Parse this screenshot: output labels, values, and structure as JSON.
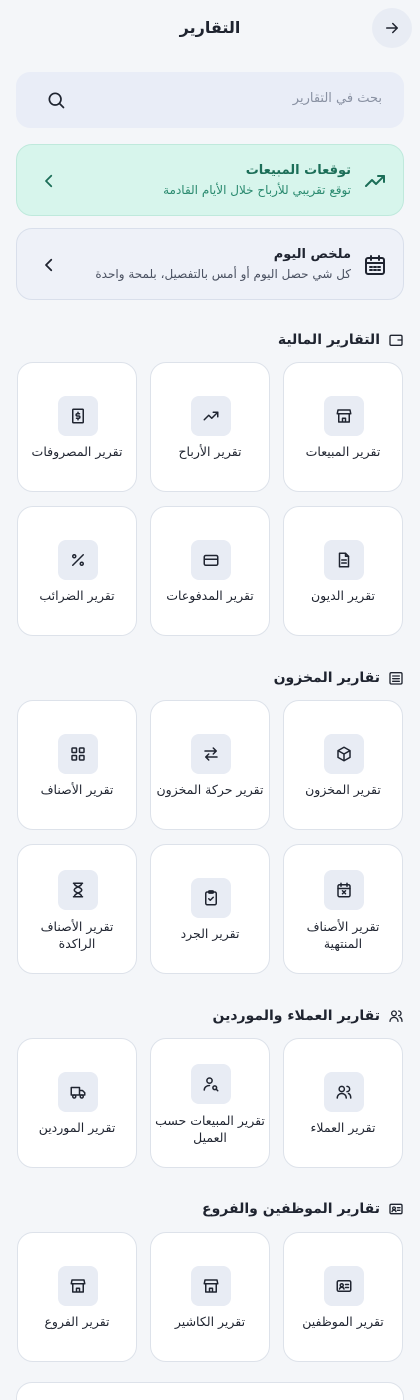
{
  "header": {
    "title": "التقارير"
  },
  "search": {
    "placeholder": "بحث في التقارير"
  },
  "forecast": {
    "title": "توقعات المبيعات",
    "subtitle": "توقع تقريبي للأرباح خلال الأيام القادمة"
  },
  "summary": {
    "title": "ملخص اليوم",
    "subtitle": "كل شي حصل اليوم أو أمس بالتفصيل، بلمحة واحدة"
  },
  "sections": {
    "financial": {
      "title": "التقارير المالية",
      "cards": [
        {
          "label": "تقرير المبيعات",
          "icon": "store-icon"
        },
        {
          "label": "تقرير الأرباح",
          "icon": "trending-up-icon"
        },
        {
          "label": "تقرير المصروفات",
          "icon": "receipt-icon"
        },
        {
          "label": "تقرير الديون",
          "icon": "document-icon"
        },
        {
          "label": "تقرير المدفوعات",
          "icon": "credit-card-icon"
        },
        {
          "label": "تقرير الضرائب",
          "icon": "percent-icon"
        }
      ]
    },
    "inventory": {
      "title": "تقارير المخزون",
      "cards": [
        {
          "label": "تقرير المخزون",
          "icon": "box-icon"
        },
        {
          "label": "تقرير حركة المخزون",
          "icon": "transfer-icon"
        },
        {
          "label": "تقرير الأصناف",
          "icon": "grid-icon"
        },
        {
          "label": "تقرير الأصناف المنتهية",
          "icon": "calendar-x-icon"
        },
        {
          "label": "تقرير الجرد",
          "icon": "clipboard-check-icon"
        },
        {
          "label": "تقرير الأصناف الراكدة",
          "icon": "hourglass-icon"
        }
      ]
    },
    "customers": {
      "title": "تقارير العملاء والموردين",
      "cards": [
        {
          "label": "تقرير العملاء",
          "icon": "users-icon"
        },
        {
          "label": "تقرير المبيعات حسب العميل",
          "icon": "user-search-icon"
        },
        {
          "label": "تقرير الموردين",
          "icon": "truck-icon"
        }
      ]
    },
    "employees": {
      "title": "تقارير الموظفين والفروع",
      "cards": [
        {
          "label": "تقرير الموظفين",
          "icon": "id-card-icon"
        },
        {
          "label": "تقرير الكاشير",
          "icon": "store-icon"
        },
        {
          "label": "تقرير الفروع",
          "icon": "store-icon"
        }
      ]
    }
  }
}
